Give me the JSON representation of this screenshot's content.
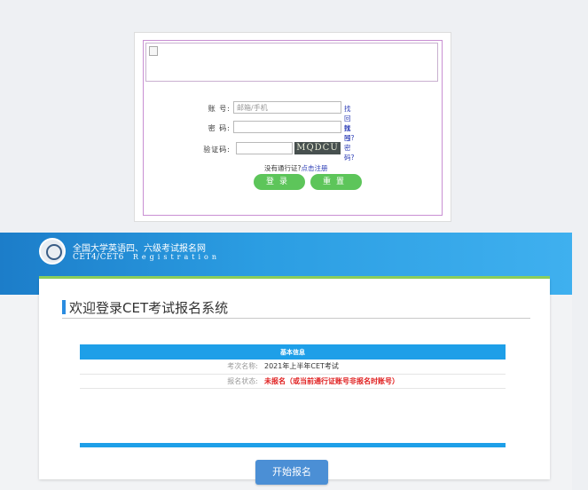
{
  "login": {
    "account_label": "账  号:",
    "account_placeholder": "邮箱/手机",
    "find_account": "找回账号?",
    "password_label": "密  码:",
    "find_password": "找回密码?",
    "captcha_label": "验证码:",
    "captcha_text": "MQDCU",
    "register_prefix": "没有通行证?",
    "register_link": "点击注册",
    "login_button": "登录",
    "reset_button": "重置"
  },
  "cet": {
    "site_title": "全国大学英语四、六级考试报名网",
    "site_sub": "CET4/CET6",
    "site_sub_en": "Registration",
    "page_title": "欢迎登录CET考试报名系统",
    "table_title": "基本信息",
    "rows": [
      {
        "key": "考次名称:",
        "value": "2021年上半年CET考试"
      },
      {
        "key": "报名状态:",
        "value": "未报名（或当前通行证账号非报名时账号）"
      }
    ],
    "start_button": "开始报名",
    "colors": {
      "header_blue": "#1c7dc9",
      "accent_green": "#8ccf5b",
      "table_blue": "#1e9fe8",
      "status_red": "#e02020"
    }
  }
}
